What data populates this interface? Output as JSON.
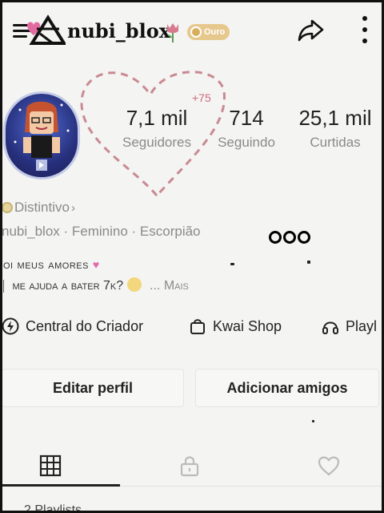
{
  "header": {
    "username": "nubi_blox",
    "level_badge": "Ouro",
    "icons": {
      "logo": "triangle-logo-icon",
      "tulip": "tulip-icon",
      "share": "share-icon",
      "more": "more-vertical-icon"
    }
  },
  "stats": {
    "new_followers": "+75",
    "followers": {
      "value": "7,1 mil",
      "label": "Seguidores"
    },
    "following": {
      "value": "714",
      "label": "Seguindo"
    },
    "likes": {
      "value": "25,1 mil",
      "label": "Curtidas"
    }
  },
  "profile": {
    "badge_label": "Distintivo",
    "info": "nubi_blox · Feminino · Escorpião",
    "bio_line1": "oi meus amores",
    "bio_line2": "me ajuda a bater 7k?",
    "more": "... Mais"
  },
  "tools": [
    {
      "label": "Central do Criador",
      "icon": "lightning-icon"
    },
    {
      "label": "Kwai Shop",
      "icon": "shopping-bag-icon"
    },
    {
      "label": "Playl",
      "icon": "headphones-icon"
    }
  ],
  "actions": {
    "edit_profile": "Editar perfil",
    "add_friends": "Adicionar amigos"
  },
  "tabs": {
    "icons": [
      "grid-icon",
      "lock-icon",
      "heart-icon"
    ],
    "active_index": 0
  },
  "partial_row": "2 Playlists",
  "colors": {
    "heart_dashes": "#c98a91",
    "badge_gold": "#e6c88d",
    "secondary_text": "#8a8a8a"
  }
}
